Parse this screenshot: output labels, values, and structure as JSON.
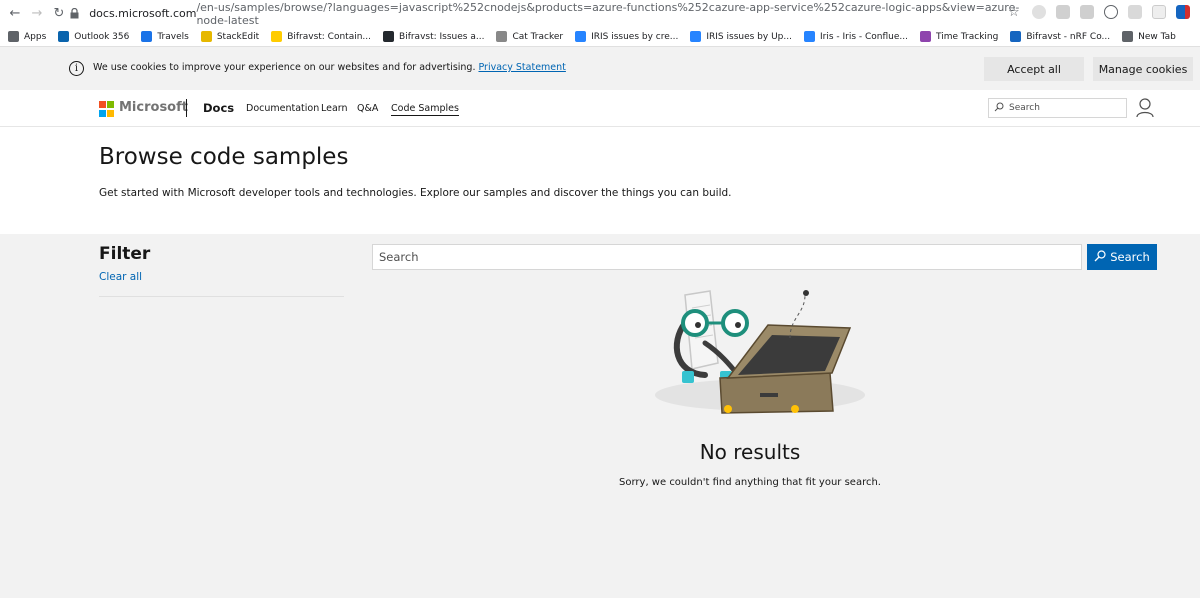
{
  "browser": {
    "url_host": "docs.microsoft.com",
    "url_rest": "/en-us/samples/browse/?languages=javascript%252cnodejs&products=azure-functions%252cazure-app-service%252cazure-logic-apps&view=azure-node-latest"
  },
  "bookmarks": [
    {
      "label": "Apps",
      "icon": "apps-grid-icon",
      "color": "#5f6368"
    },
    {
      "label": "Outlook 356",
      "icon": "outlook-icon",
      "color": "#0a64ad"
    },
    {
      "label": "Travels",
      "icon": "travels-icon",
      "color": "#1a73e8"
    },
    {
      "label": "StackEdit",
      "icon": "stackedit-icon",
      "color": "#e6b800"
    },
    {
      "label": "Bifravst: Contain...",
      "icon": "bifravst-icon",
      "color": "#ffcc00"
    },
    {
      "label": "Bifravst: Issues a...",
      "icon": "github-icon",
      "color": "#24292e"
    },
    {
      "label": "Cat Tracker",
      "icon": "cat-icon",
      "color": "#888888"
    },
    {
      "label": "IRIS issues by cre...",
      "icon": "jira-icon",
      "color": "#2684ff"
    },
    {
      "label": "IRIS issues by Up...",
      "icon": "jira-icon",
      "color": "#2684ff"
    },
    {
      "label": "Iris - Iris - Conflue...",
      "icon": "confluence-icon",
      "color": "#2684ff"
    },
    {
      "label": "Time Tracking",
      "icon": "time-tracking-icon",
      "color": "#8e44ad"
    },
    {
      "label": "Bifravst - nRF Co...",
      "icon": "nrf-icon",
      "color": "#1565c0"
    },
    {
      "label": "New Tab",
      "icon": "globe-icon",
      "color": "#5f6368"
    }
  ],
  "cookie": {
    "text": "We use cookies to improve your experience on our websites and for advertising.",
    "link": "Privacy Statement",
    "accept": "Accept all",
    "manage": "Manage cookies"
  },
  "header": {
    "brand": "Microsoft",
    "docs": "Docs",
    "nav": [
      "Documentation",
      "Learn",
      "Q&A",
      "Code Samples"
    ],
    "search_placeholder": "Search"
  },
  "hero": {
    "title": "Browse code samples",
    "subtitle": "Get started with Microsoft developer tools and technologies. Explore our samples and discover the things you can build."
  },
  "filter": {
    "title": "Filter",
    "clear": "Clear all"
  },
  "search": {
    "placeholder": "Search",
    "button": "Search"
  },
  "results": {
    "title": "No results",
    "message": "Sorry, we couldn't find anything that fit your search."
  },
  "colors": {
    "accent": "#0065b3",
    "ms_red": "#f25022",
    "ms_green": "#7fba00",
    "ms_blue": "#00a4ef",
    "ms_yellow": "#ffb900"
  }
}
